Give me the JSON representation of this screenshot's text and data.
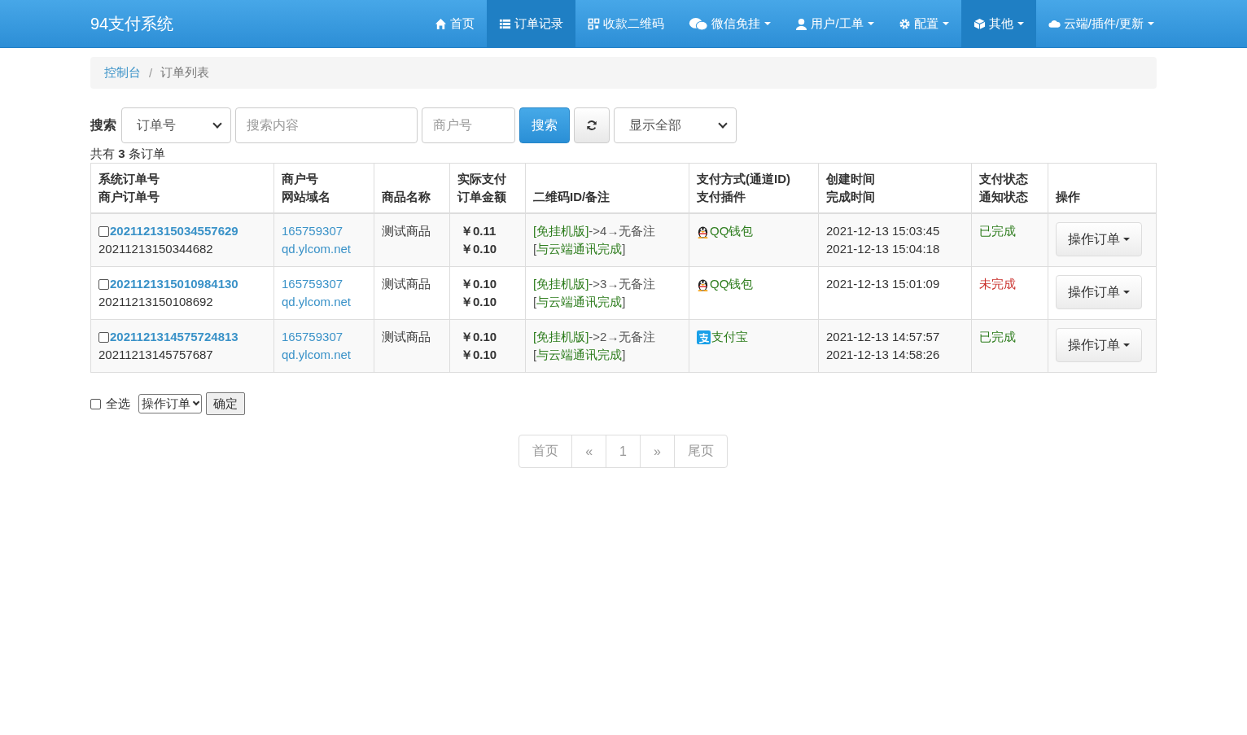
{
  "navbar": {
    "brand": "94支付系统",
    "items": [
      {
        "label": "首页",
        "kind": "home",
        "dropdown": false,
        "selected": false
      },
      {
        "label": "订单记录",
        "kind": "list",
        "dropdown": false,
        "selected": true
      },
      {
        "label": "收款二维码",
        "kind": "qrcode",
        "dropdown": false,
        "selected": false
      },
      {
        "label": "微信免挂",
        "kind": "wechat",
        "dropdown": true,
        "selected": false
      },
      {
        "label": "用户/工单",
        "kind": "user",
        "dropdown": true,
        "selected": false
      },
      {
        "label": "配置",
        "kind": "gear",
        "dropdown": true,
        "selected": false
      },
      {
        "label": "其他",
        "kind": "cube",
        "dropdown": true,
        "selected": true
      },
      {
        "label": "云端/插件/更新",
        "kind": "cloud",
        "dropdown": true,
        "selected": false
      }
    ]
  },
  "breadcrumb": {
    "items": [
      "控制台",
      "订单列表"
    ],
    "separator": "/"
  },
  "search": {
    "label": "搜索",
    "type_select": "订单号",
    "query_placeholder": "搜索内容",
    "merchant_placeholder": "商户号",
    "button": "搜索",
    "filter_select": "显示全部"
  },
  "summary": [
    "共有 ",
    "3",
    " 条订单"
  ],
  "table": {
    "columns": [
      [
        "系统订单号",
        "商户订单号"
      ],
      [
        "商户号",
        "网站域名"
      ],
      [
        "商品名称"
      ],
      [
        "实际支付",
        "订单金额"
      ],
      [
        "二维码ID/备注"
      ],
      [
        "支付方式(通道ID)",
        "支付插件"
      ],
      [
        "创建时间",
        "完成时间"
      ],
      [
        "支付状态",
        "通知状态"
      ],
      [
        "操作"
      ]
    ],
    "rows": [
      {
        "checked": false,
        "trade_no": "2021121315034557629",
        "out_trade_no": "20211213150344682",
        "merchant_id": "165759307",
        "domain": "qd.ylcom.net",
        "product": "测试商品",
        "paid": "￥0.11",
        "amount": "￥0.10",
        "note_line1": [
          {
            "kind": "link",
            "text": "[免挂机版]"
          },
          {
            "kind": "plain",
            "text": "->4→无备注"
          }
        ],
        "note_line2": [
          {
            "kind": "plain",
            "text": "["
          },
          {
            "kind": "link",
            "text": "与云端通讯完成"
          },
          {
            "kind": "plain",
            "text": "]"
          }
        ],
        "kind": "qq",
        "pay_method": "QQ钱包",
        "created": "2021-12-13 15:03:45",
        "finished": "2021-12-13 15:04:18",
        "status": "已完成",
        "done": true,
        "action": "操作订单"
      },
      {
        "checked": false,
        "trade_no": "2021121315010984130",
        "out_trade_no": "20211213150108692",
        "merchant_id": "165759307",
        "domain": "qd.ylcom.net",
        "product": "测试商品",
        "paid": "￥0.10",
        "amount": "￥0.10",
        "note_line1": [
          {
            "kind": "link",
            "text": "[免挂机版]"
          },
          {
            "kind": "plain",
            "text": "->3→无备注"
          }
        ],
        "note_line2": [
          {
            "kind": "plain",
            "text": "["
          },
          {
            "kind": "link",
            "text": "与云端通讯完成"
          },
          {
            "kind": "plain",
            "text": "]"
          }
        ],
        "kind": "qq",
        "pay_method": "QQ钱包",
        "created": "2021-12-13 15:01:09",
        "status": "未完成",
        "done": false,
        "action": "操作订单"
      },
      {
        "checked": false,
        "trade_no": "2021121314575724813",
        "out_trade_no": "20211213145757687",
        "merchant_id": "165759307",
        "domain": "qd.ylcom.net",
        "product": "测试商品",
        "paid": "￥0.10",
        "amount": "￥0.10",
        "note_line1": [
          {
            "kind": "link",
            "text": "[免挂机版]"
          },
          {
            "kind": "plain",
            "text": "->2→无备注"
          }
        ],
        "note_line2": [
          {
            "kind": "plain",
            "text": "["
          },
          {
            "kind": "link",
            "text": "与云端通讯完成"
          },
          {
            "kind": "plain",
            "text": "]"
          }
        ],
        "kind": "alipay",
        "pay_method": "支付宝",
        "created": "2021-12-13 14:57:57",
        "finished": "2021-12-13 14:58:26",
        "status": "已完成",
        "done": true,
        "action": "操作订单"
      }
    ]
  },
  "bulk": {
    "select_all": "全选",
    "select_all_checked": false,
    "action_select": "操作订单",
    "confirm": "确定"
  },
  "pagination": [
    "首页",
    "«",
    "1",
    "»",
    "尾页"
  ]
}
